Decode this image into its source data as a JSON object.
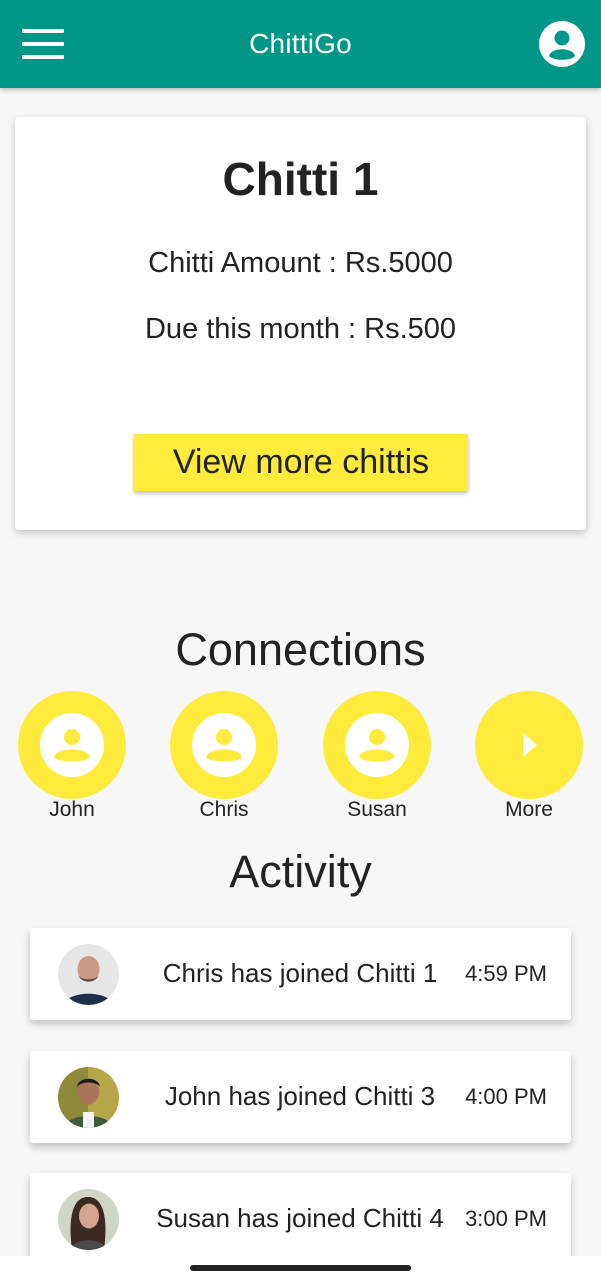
{
  "appbar": {
    "title": "ChittiGo",
    "menu_icon": "menu-icon",
    "profile_icon": "account-circle-icon",
    "color": "#009688"
  },
  "chitti": {
    "title": "Chitti 1",
    "amount_text": "Chitti Amount : Rs.5000",
    "due_text": "Due this month : Rs.500",
    "view_more_label": "View more chittis",
    "button_color": "#ffeb3b"
  },
  "connections": {
    "heading": "Connections",
    "items": [
      {
        "label": "John",
        "icon": "person-icon"
      },
      {
        "label": "Chris",
        "icon": "person-icon"
      },
      {
        "label": "Susan",
        "icon": "person-icon"
      },
      {
        "label": "More",
        "icon": "play-arrow-icon"
      }
    ]
  },
  "activity": {
    "heading": "Activity",
    "items": [
      {
        "text": "Chris has joined Chitti 1",
        "time": "4:59 PM"
      },
      {
        "text": "John has joined Chitti 3",
        "time": "4:00 PM"
      },
      {
        "text": "Susan has joined Chitti 4",
        "time": "3:00 PM"
      }
    ]
  }
}
